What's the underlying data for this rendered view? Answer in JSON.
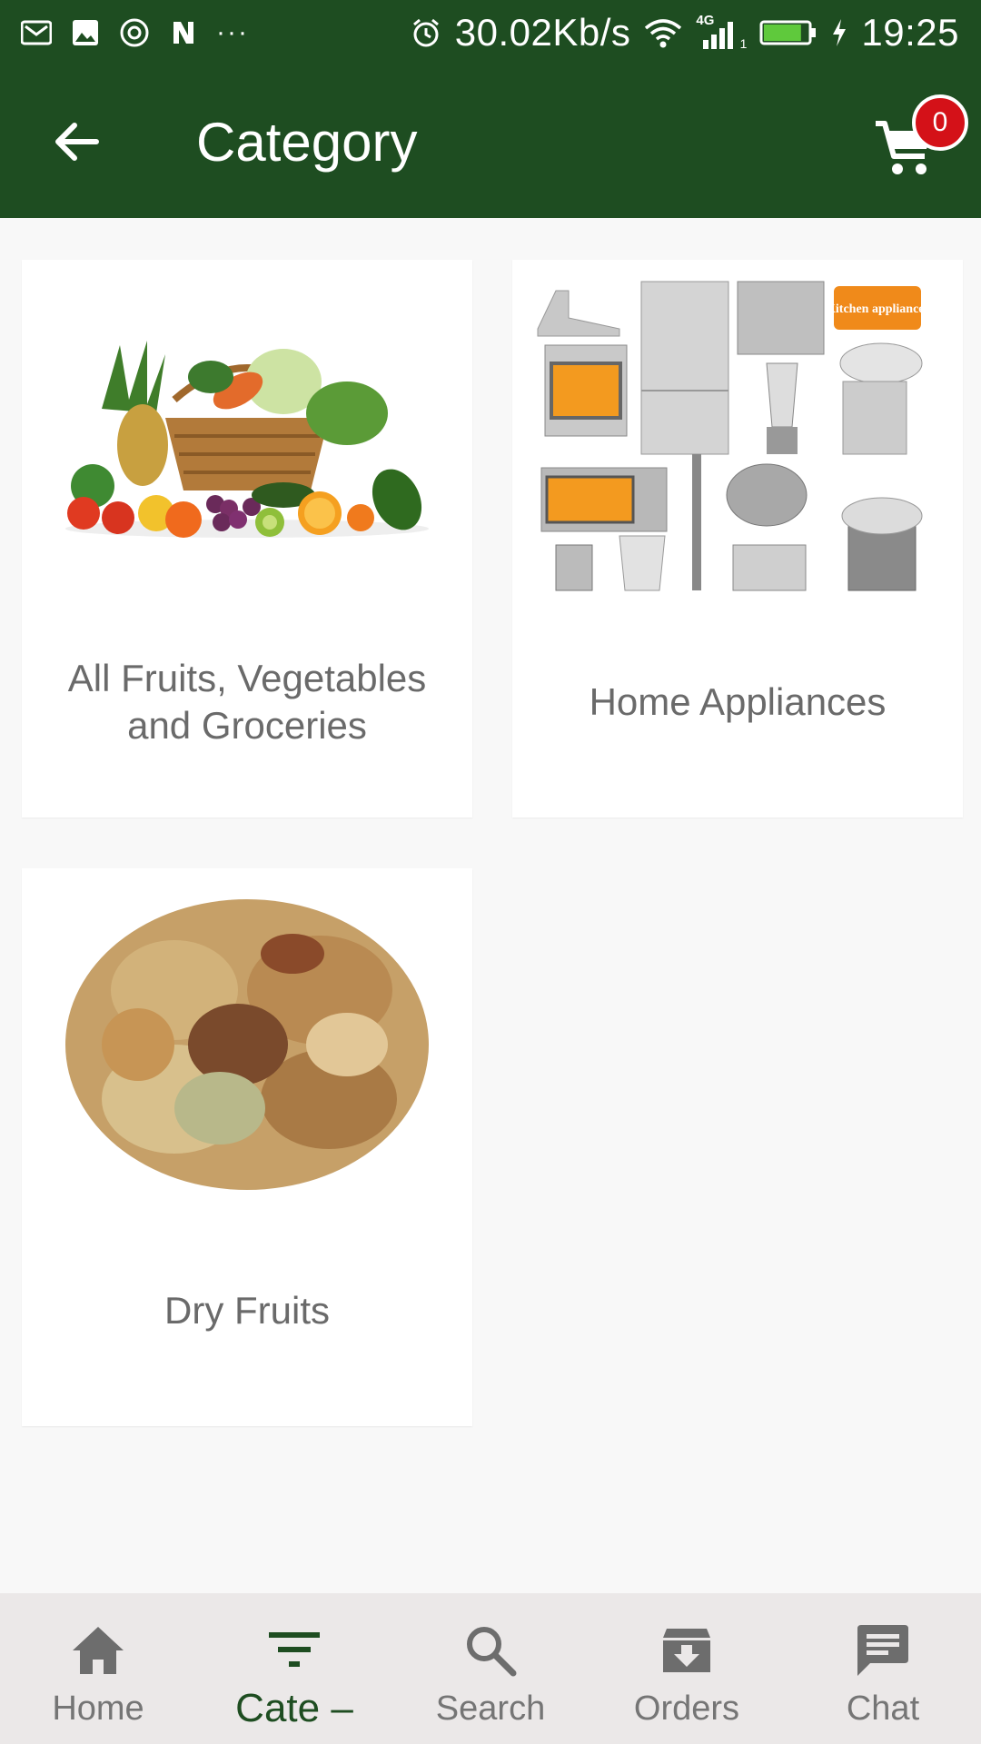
{
  "status_bar": {
    "network_speed": "30.02Kb/s",
    "network_type": "4G",
    "sim_slot": "1",
    "time": "19:25",
    "overflow": "···",
    "battery_level_pct": 85,
    "icons": [
      "gmail-icon",
      "gallery-icon",
      "vpn-icon",
      "n-icon",
      "alarm-icon",
      "wifi-icon",
      "signal-icon",
      "battery-icon",
      "charging-icon"
    ]
  },
  "app_bar": {
    "title": "Category",
    "cart_count": "0",
    "color": "#1e4d21",
    "badge_color": "#d41118"
  },
  "categories": [
    {
      "label": "All Fruits, Vegetables and Groceries",
      "image": "fruits-vegetables-basket"
    },
    {
      "label": "Home Appliances",
      "image": "kitchen-appliances-collage",
      "image_caption": "Kitchen appliances"
    },
    {
      "label": "Dry Fruits",
      "image": "mixed-nuts-pile"
    }
  ],
  "bottom_nav": {
    "items": [
      {
        "label": "Home",
        "icon": "home-icon",
        "active": false
      },
      {
        "label": "Cate –",
        "icon": "filter-icon",
        "active": true
      },
      {
        "label": "Search",
        "icon": "search-icon",
        "active": false
      },
      {
        "label": "Orders",
        "icon": "orders-box-icon",
        "active": false
      },
      {
        "label": "Chat",
        "icon": "chat-icon",
        "active": false
      }
    ]
  }
}
